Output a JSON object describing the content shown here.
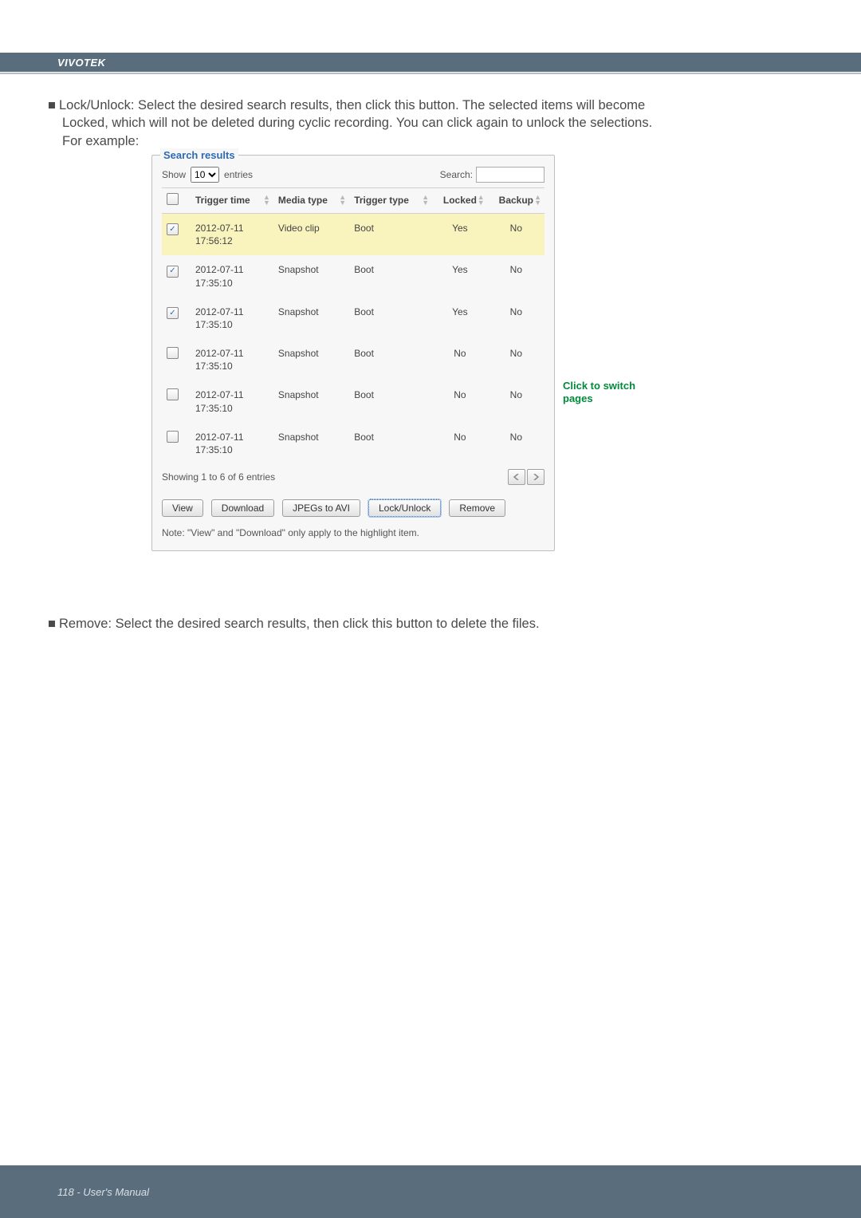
{
  "brand": "VIVOTEK",
  "footer": "118 - User's Manual",
  "text": {
    "lock_line1_prefix": "■ ",
    "lock_line1": "Lock/Unlock: Select the desired search results, then click this button. The selected items will become",
    "lock_line2": "Locked, which will not be deleted during cyclic recording. You can click again to unlock the selections.",
    "lock_line3": "For example:",
    "remove_prefix": "■ ",
    "remove_line": "Remove: Select the desired search results, then click this button to delete the files."
  },
  "panel": {
    "legend": "Search results",
    "show_label_left": "Show",
    "show_value": "10",
    "show_label_right": "entries",
    "search_label": "Search:",
    "columns": {
      "trigger_time": "Trigger time",
      "media_type": "Media type",
      "trigger_type": "Trigger type",
      "locked": "Locked",
      "backup": "Backup"
    },
    "rows": [
      {
        "checked": true,
        "highlight": true,
        "time": "2012-07-11 17:56:12",
        "media": "Video clip",
        "trigger": "Boot",
        "locked": "Yes",
        "backup": "No"
      },
      {
        "checked": true,
        "highlight": false,
        "time": "2012-07-11 17:35:10",
        "media": "Snapshot",
        "trigger": "Boot",
        "locked": "Yes",
        "backup": "No"
      },
      {
        "checked": true,
        "highlight": false,
        "time": "2012-07-11 17:35:10",
        "media": "Snapshot",
        "trigger": "Boot",
        "locked": "Yes",
        "backup": "No"
      },
      {
        "checked": false,
        "highlight": false,
        "time": "2012-07-11 17:35:10",
        "media": "Snapshot",
        "trigger": "Boot",
        "locked": "No",
        "backup": "No"
      },
      {
        "checked": false,
        "highlight": false,
        "time": "2012-07-11 17:35:10",
        "media": "Snapshot",
        "trigger": "Boot",
        "locked": "No",
        "backup": "No"
      },
      {
        "checked": false,
        "highlight": false,
        "time": "2012-07-11 17:35:10",
        "media": "Snapshot",
        "trigger": "Boot",
        "locked": "No",
        "backup": "No"
      }
    ],
    "showing_text": "Showing 1 to 6 of 6 entries",
    "buttons": {
      "view": "View",
      "download": "Download",
      "jpegs": "JPEGs to AVI",
      "lock": "Lock/Unlock",
      "remove": "Remove"
    },
    "note": "Note: \"View\" and \"Download\" only apply to the highlight item."
  },
  "annotation": {
    "line1": "Click to switch",
    "line2": "pages"
  }
}
